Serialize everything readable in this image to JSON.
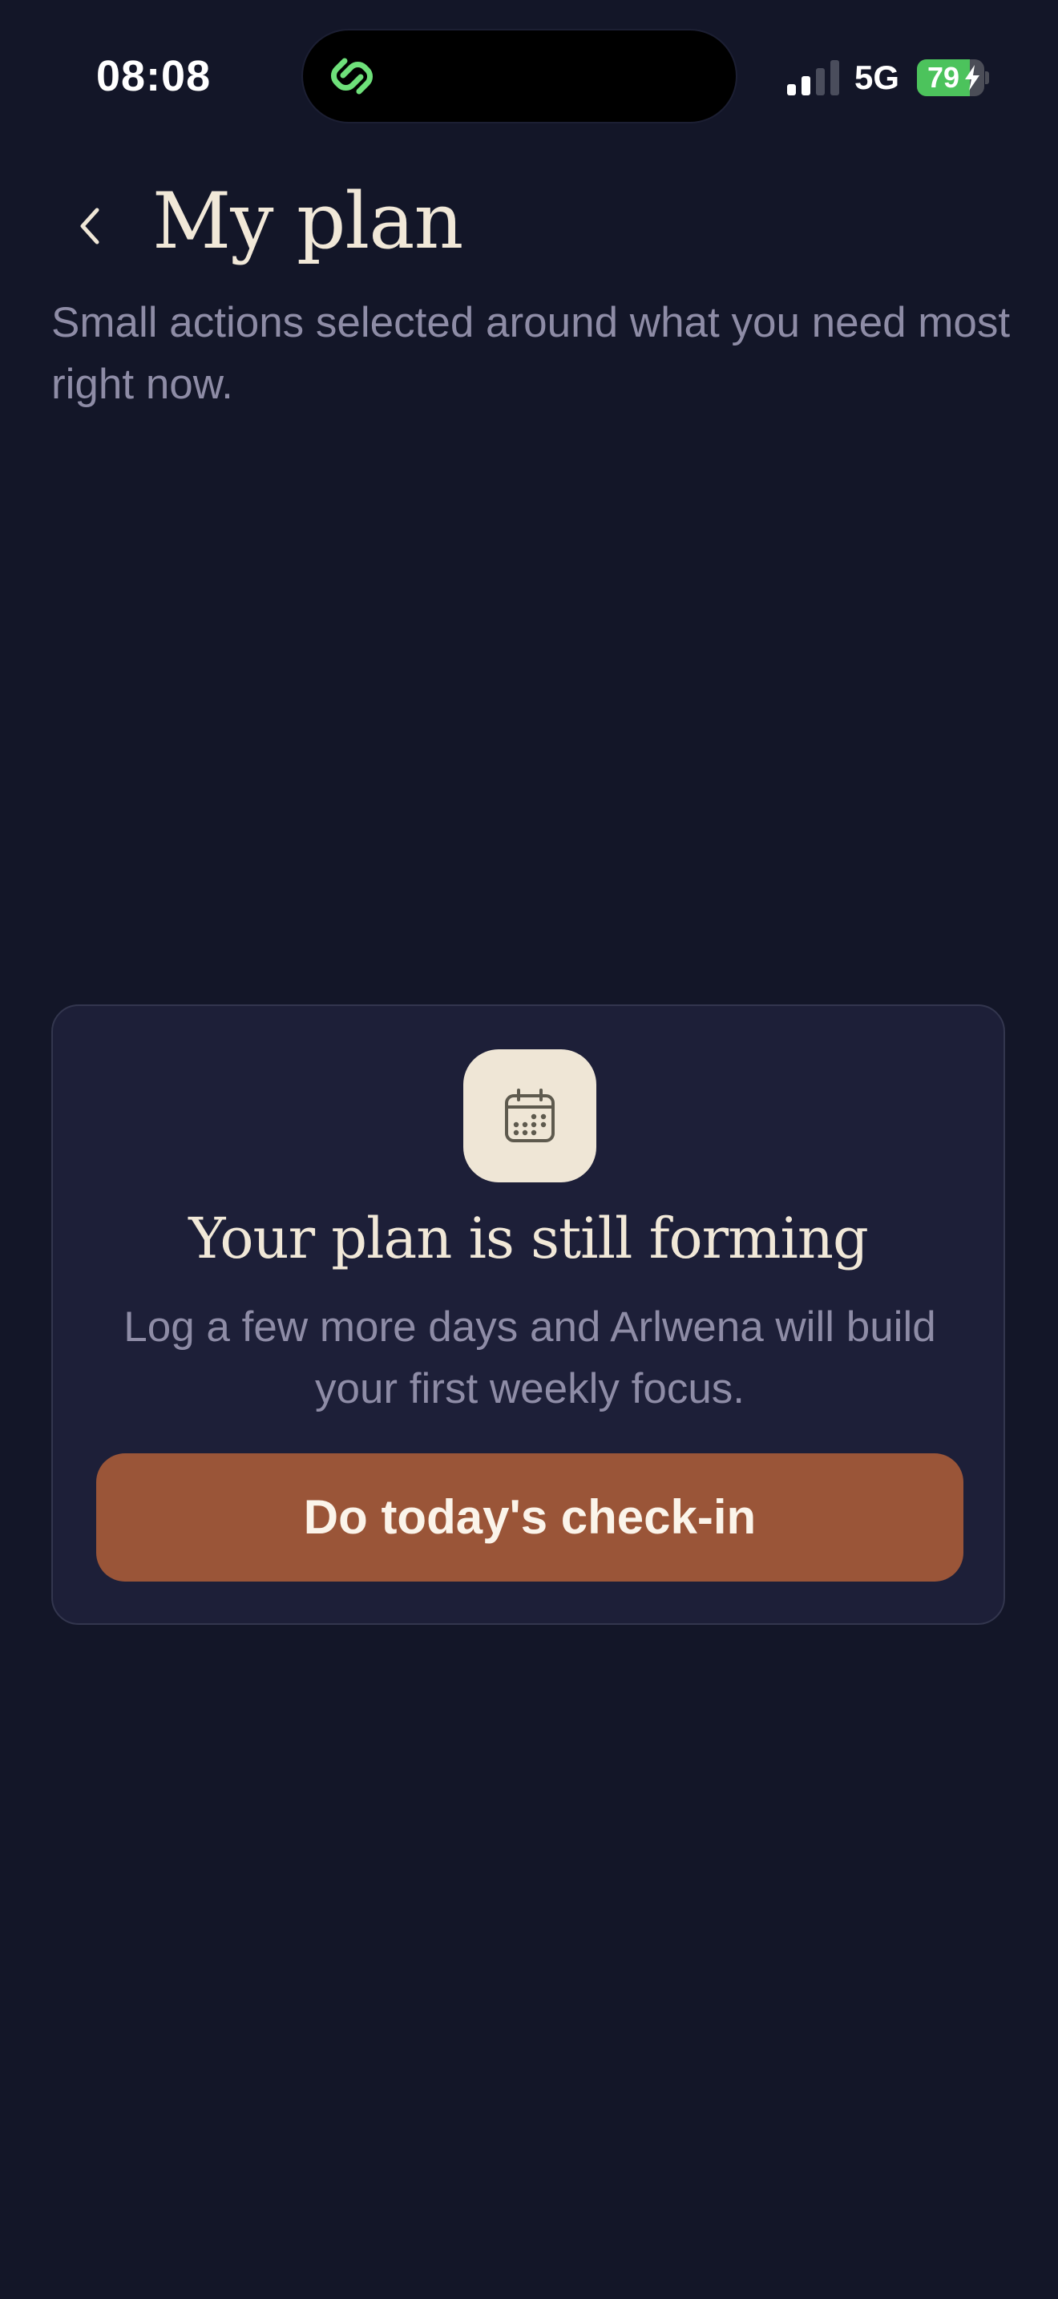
{
  "status_bar": {
    "time": "08:08",
    "network": "5G",
    "battery_level": "79",
    "battery_fraction": 0.79,
    "battery_charging": true,
    "signal_bars_active": 2,
    "signal_bars_total": 4,
    "island_app_icon": "linked-rings-icon",
    "colors": {
      "island_icon": "#6EE07A",
      "battery_fill": "#4CC35C"
    }
  },
  "header": {
    "back_icon": "chevron-left-icon",
    "title": "My plan",
    "subtitle": "Small actions selected around what you need most right now."
  },
  "empty_state": {
    "icon": "calendar-icon",
    "title": "Your plan is still forming",
    "body": "Log a few more days and Arlwena will build your first weekly focus.",
    "cta_label": "Do today's check-in"
  },
  "theme": {
    "background": "#131628",
    "card_background": "#1D1F38",
    "card_border": "#33364E",
    "title_text": "#F1E8D8",
    "muted_text": "#8E8CA6",
    "accent_button": "#9A5538",
    "badge_background": "#EFE6D6"
  }
}
